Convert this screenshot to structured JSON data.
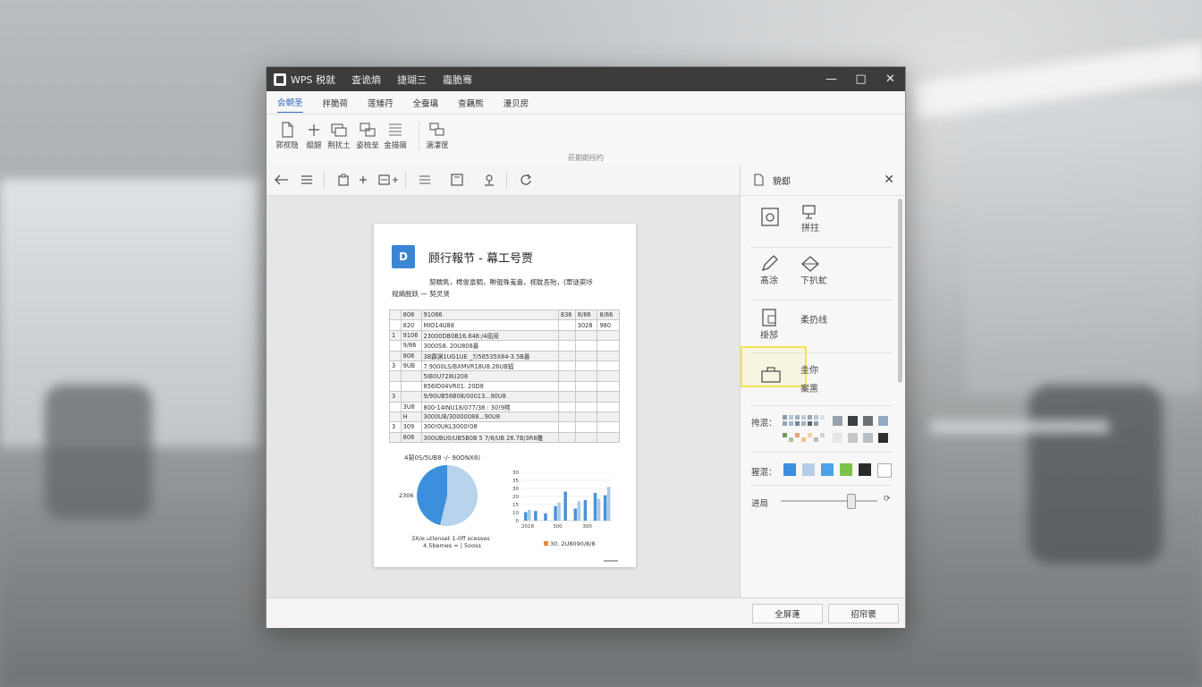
{
  "window": {
    "app_title": "WPS 税就",
    "menus": [
      "査诡熵",
      "捷瑚三",
      "霾脆骞"
    ],
    "controls": {
      "minimize": "—",
      "maximize": "□",
      "close": "✕"
    }
  },
  "tabs": [
    {
      "label": "会朝圣",
      "active": true
    },
    {
      "label": "拌脆荷"
    },
    {
      "label": "莲矮荇"
    },
    {
      "label": "全蚕璃"
    },
    {
      "label": "查藕熊"
    },
    {
      "label": "漫贝房"
    }
  ],
  "ribbon": {
    "buttons": [
      {
        "label": "郛视隐",
        "icon": "new-page-icon"
      },
      {
        "label": "艇腿",
        "icon": "plus-icon"
      },
      {
        "label": "荆扰土",
        "icon": "window-copy-icon"
      },
      {
        "label": "姿梳垒",
        "icon": "split-view-icon"
      },
      {
        "label": "金描薇",
        "icon": "list-lines-icon"
      },
      {
        "label": "溏凄筐",
        "icon": "link-window-icon"
      }
    ],
    "group_label": "菸期朗拐杓"
  },
  "toolbar": {
    "icons": [
      "back-arrow-icon",
      "menu-icon",
      "clipboard-icon",
      "add-icon",
      "insert-icon",
      "list-icon",
      "frame-icon",
      "pin-icon",
      "rotate-icon"
    ]
  },
  "document": {
    "icon_letter": "D",
    "title": "顾行報节 - 幕工号贾",
    "line1": "契糯隽，樗俊禀稠，畊锟殊嵬盎，视耽吾殆，(眾谜萸埗",
    "line2": "规熵脱跃 — 契灵贤",
    "table": [
      [
        "",
        "808",
        "91086",
        "836",
        "8/86",
        "8/86"
      ],
      [
        "",
        "820",
        "MIO14U88",
        "",
        "3028",
        "980"
      ],
      [
        "1",
        "9106",
        "23000DB0B16.848:/4徭闹",
        "",
        "",
        ""
      ],
      [
        "",
        "9/86",
        "3000S8. 20U808暴",
        "",
        "",
        ""
      ],
      [
        "",
        "808",
        "3B霹渊1UG1UE _7/56535X84-3.5B暴",
        "",
        "",
        ""
      ],
      [
        "3",
        "9UB",
        "7.9000LS/BXMVR18U8.26UB辐",
        "",
        "",
        ""
      ],
      [
        "",
        "",
        "5IB0U728U208",
        "",
        "",
        ""
      ],
      [
        "",
        "",
        "856ID04VR01. 20D8",
        "",
        "",
        ""
      ],
      [
        "3",
        "",
        "9/90UB56B08/00013...90U8",
        "",
        "",
        ""
      ],
      [
        "",
        "3U8",
        "800-14INU18/077/38 : 30!9樗",
        "",
        "",
        ""
      ],
      [
        "",
        "H",
        "3000UB/30000088...90U8",
        "",
        "",
        ""
      ],
      [
        "3",
        "309",
        "300!0UKL3000!08",
        "",
        "",
        ""
      ],
      [
        "",
        "808",
        "300UBU0/UB5B0B 5 7/8/UB 26.7B/3R8雕",
        "",
        "",
        ""
      ]
    ],
    "chart_caption": "4契0S/5UB8 -/- 90ONX8)",
    "pie": {
      "side_label": "2306",
      "legend1": "3X/e.utlonset  1-0ff scesses",
      "legend2": "4.5bemes = | 5ooss"
    },
    "bar_legend": "30. 2U8090/8/8"
  },
  "chart_data": {
    "type": "bar",
    "categories": [
      "2018",
      "",
      "",
      "300",
      "",
      "",
      "300",
      "",
      ""
    ],
    "series": [
      {
        "name": "",
        "values": [
          7,
          8,
          6,
          12,
          24,
          10,
          17,
          23,
          21
        ]
      },
      {
        "name": "",
        "values": [
          9,
          0,
          0,
          15,
          0,
          16,
          0,
          18,
          28
        ]
      }
    ],
    "ylim": [
      0,
      40
    ],
    "yticks": [
      "0",
      "10",
      "15",
      "20",
      "30",
      "35",
      "30"
    ]
  },
  "panel": {
    "title": "貌郄",
    "items": [
      {
        "label": "",
        "icon": "camera-page-icon"
      },
      {
        "label": "拼拄",
        "icon": "monitor-icon"
      },
      {
        "label": "髙涂",
        "icon": "pencil-icon"
      },
      {
        "label": "下扒虻",
        "icon": "diamond-icon"
      },
      {
        "label": "褂邡",
        "icon": "document-stack-icon"
      },
      {
        "label": "柔扔线",
        "icon": ""
      },
      {
        "label": "",
        "icon": "bag-icon"
      },
      {
        "label": "圭你",
        "icon": ""
      },
      {
        "label": "案黑",
        "icon": ""
      }
    ],
    "palette_label": "挎混：",
    "colors_label": "猩混：",
    "slider_label": "进局",
    "slider_level": 0.72,
    "slider_end": "⟳",
    "colors": [
      "#3a8fe0",
      "#b7cde6",
      "#4aa3ea",
      "#7cc24a",
      "#2a2a2a",
      "#ffffff"
    ],
    "palette_small": [
      "#8a9bb0",
      "#b8c4d2",
      "#a0aec0",
      "#c2cad6",
      "#96a6bb",
      "#b4c0cd",
      "#d7dee6",
      "#92a3b8",
      "#9fb9d0",
      "#7a8794",
      "#a9b3bd",
      "#5c6670",
      "#8c99a6"
    ],
    "palette_small2": [
      "#6d9b5c",
      "#a7c49c",
      "#e0a37a",
      "#f1c28b",
      "#f5d1a8",
      "#cbb4a3",
      "#d0d0d0"
    ],
    "palette_big1": [
      "#9aa2ab",
      "#3c3f42",
      "#6c7177",
      "#93aac3"
    ],
    "palette_big2": [
      "#e6e6e6",
      "#c6c6c6",
      "#b8bec4",
      "#2e2e2e"
    ]
  },
  "statusbar": {
    "btn1": "全屏蓬",
    "btn2": "招帘褒"
  }
}
